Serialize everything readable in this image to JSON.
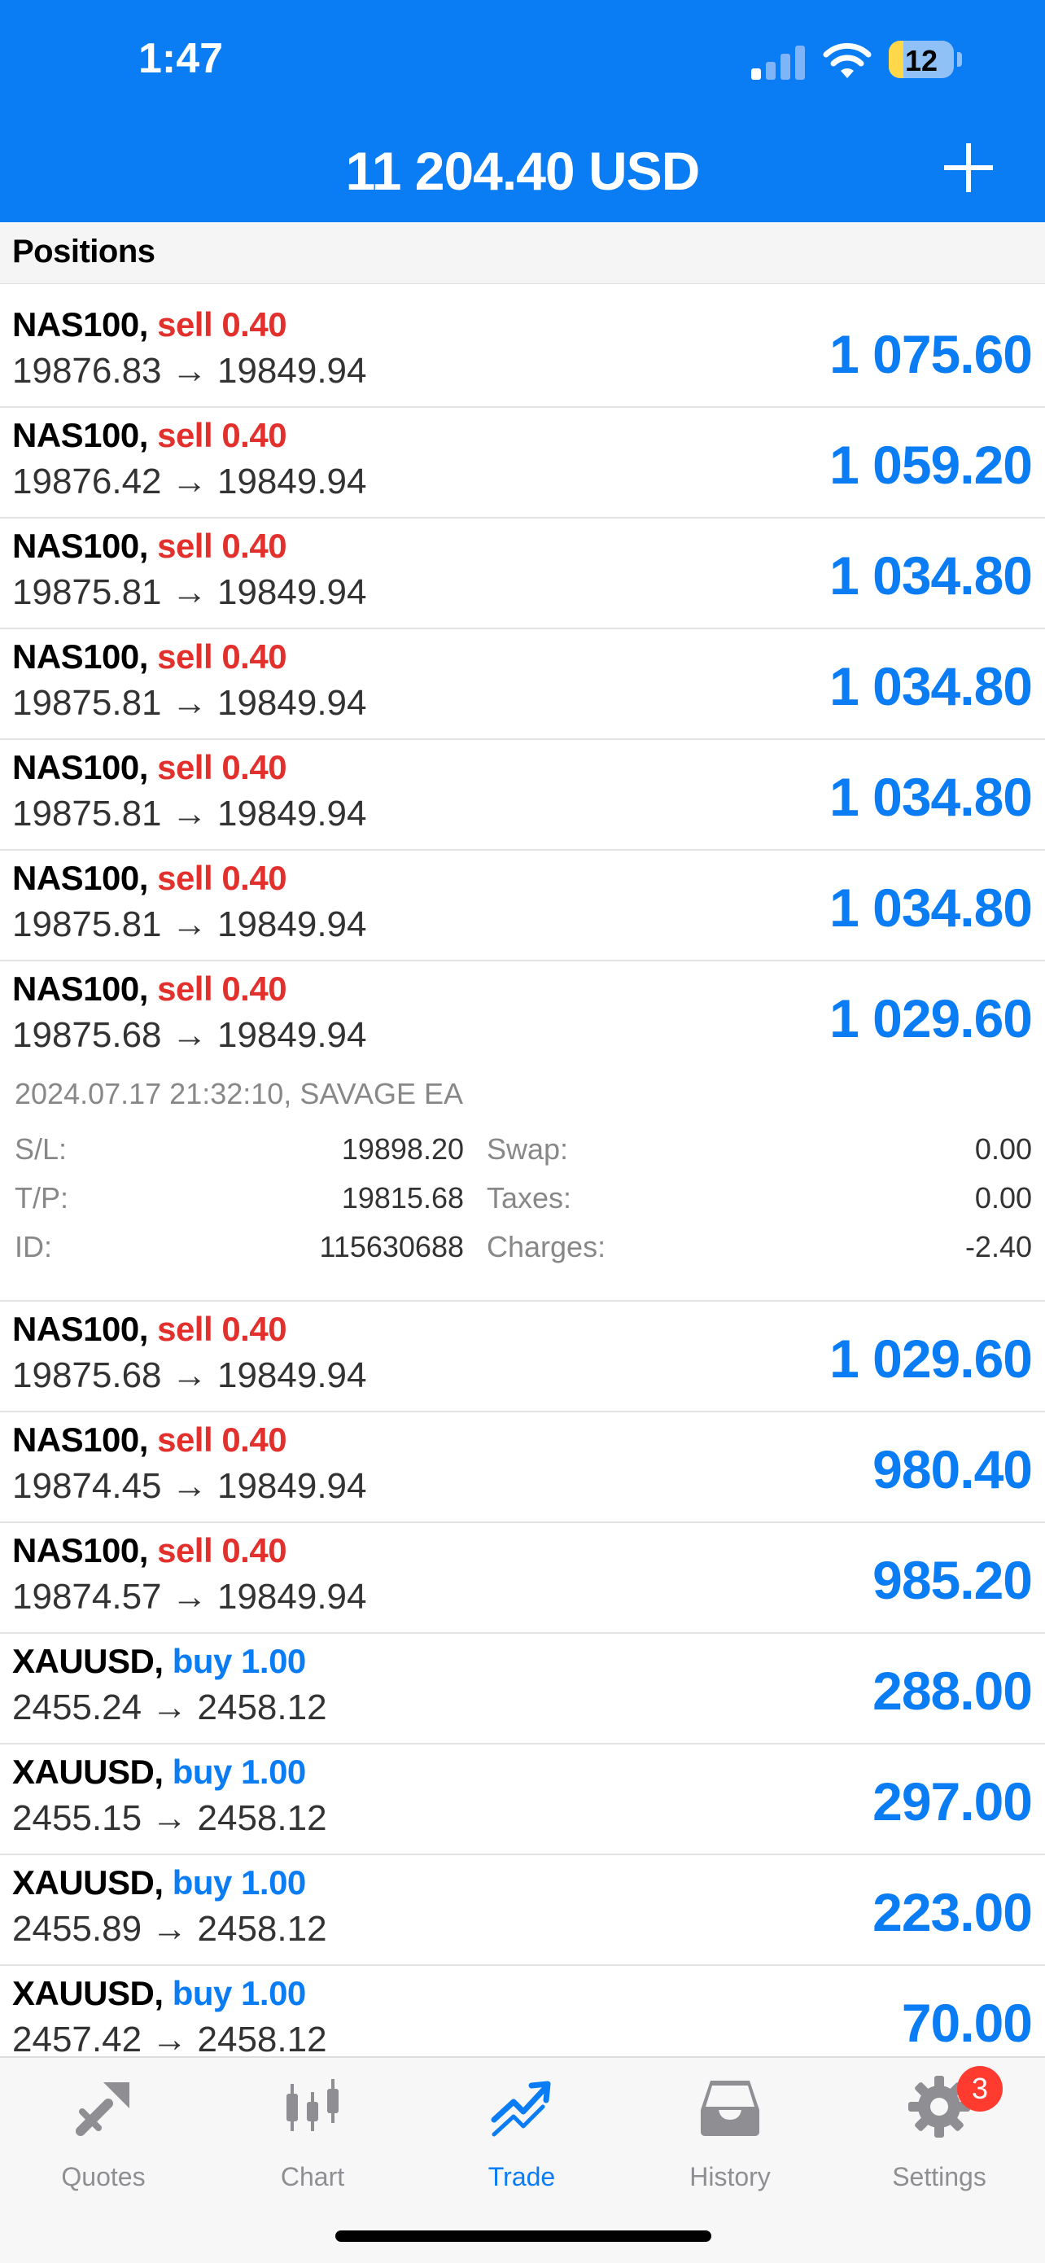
{
  "status_bar": {
    "time": "1:47",
    "battery": "12"
  },
  "header": {
    "balance": "11 204.40 USD"
  },
  "section": {
    "title": "Positions"
  },
  "positions": [
    {
      "symbol": "NAS100,",
      "side": "sell 0.40",
      "prices": "19876.83 → 19849.94",
      "profit": "1 075.60"
    },
    {
      "symbol": "NAS100,",
      "side": "sell 0.40",
      "prices": "19876.42 → 19849.94",
      "profit": "1 059.20"
    },
    {
      "symbol": "NAS100,",
      "side": "sell 0.40",
      "prices": "19875.81 → 19849.94",
      "profit": "1 034.80"
    },
    {
      "symbol": "NAS100,",
      "side": "sell 0.40",
      "prices": "19875.81 → 19849.94",
      "profit": "1 034.80"
    },
    {
      "symbol": "NAS100,",
      "side": "sell 0.40",
      "prices": "19875.81 → 19849.94",
      "profit": "1 034.80"
    },
    {
      "symbol": "NAS100,",
      "side": "sell 0.40",
      "prices": "19875.81 → 19849.94",
      "profit": "1 034.80"
    },
    {
      "symbol": "NAS100,",
      "side": "sell 0.40",
      "prices": "19875.68 → 19849.94",
      "profit": "1 029.60"
    },
    {
      "symbol": "NAS100,",
      "side": "sell 0.40",
      "prices": "19875.68 → 19849.94",
      "profit": "1 029.60"
    },
    {
      "symbol": "NAS100,",
      "side": "sell 0.40",
      "prices": "19874.45 → 19849.94",
      "profit": "980.40"
    },
    {
      "symbol": "NAS100,",
      "side": "sell 0.40",
      "prices": "19874.57 → 19849.94",
      "profit": "985.20"
    },
    {
      "symbol": "XAUUSD,",
      "side": "buy 1.00",
      "prices": "2455.24 → 2458.12",
      "profit": "288.00"
    },
    {
      "symbol": "XAUUSD,",
      "side": "buy 1.00",
      "prices": "2455.15 → 2458.12",
      "profit": "297.00"
    },
    {
      "symbol": "XAUUSD,",
      "side": "buy 1.00",
      "prices": "2455.89 → 2458.12",
      "profit": "223.00"
    },
    {
      "symbol": "XAUUSD,",
      "side": "buy 1.00",
      "prices": "2457.42 → 2458.12",
      "profit": "70.00"
    }
  ],
  "details": {
    "meta": "2024.07.17 21:32:10, SAVAGE EA",
    "sl_label": "S/L:",
    "sl": "19898.20",
    "tp_label": "T/P:",
    "tp": "19815.68",
    "id_label": "ID:",
    "id": "115630688",
    "swap_label": "Swap:",
    "swap": "0.00",
    "taxes_label": "Taxes:",
    "taxes": "0.00",
    "charges_label": "Charges:",
    "charges": "-2.40"
  },
  "tabs": [
    {
      "label": "Quotes"
    },
    {
      "label": "Chart"
    },
    {
      "label": "Trade"
    },
    {
      "label": "History"
    },
    {
      "label": "Settings"
    }
  ],
  "settings_badge": "3",
  "colors": {
    "brand": "#0a7cf4",
    "sell": "#e2312d",
    "badge": "#ff3b30"
  }
}
